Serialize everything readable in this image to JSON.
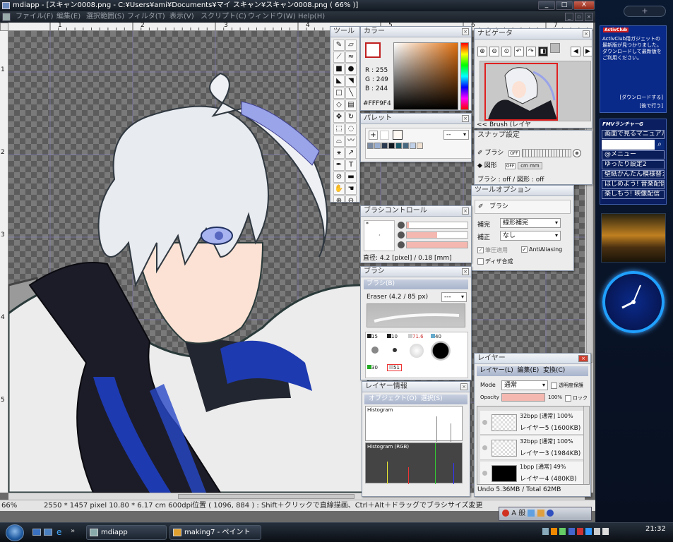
{
  "window": {
    "title": "mdiapp - [スキャン0008.png - C:¥Users¥ami¥Documents¥マイ スキャン¥スキャン0008.png ( 66% )]",
    "min": "_",
    "max": "□",
    "close": "X"
  },
  "menu": {
    "items": [
      "ファイル(F)",
      "編集(E)",
      "選択範囲(S)",
      "フィルタ(T)",
      "表示(V)",
      "スクリプト(C)",
      "ウィンドウ(W)",
      "Help(H)"
    ],
    "mdi_min": "_",
    "mdi_restore": "▫",
    "mdi_close": "×"
  },
  "ruler": {
    "top": [
      "1",
      "2",
      "3",
      "4",
      "5",
      "6",
      "7"
    ],
    "left": [
      "1",
      "2",
      "3",
      "4",
      "5"
    ]
  },
  "tools_panel": {
    "title": "ツール"
  },
  "color_panel": {
    "title": "カラー",
    "r": "R : 255",
    "g": "G : 249",
    "b": "B : 244",
    "hex": "#FFF9F4"
  },
  "palette_panel": {
    "title": "パレット",
    "add": "+",
    "dropdown": "--",
    "swatches": [
      "#7a8aa0",
      "#9aaed0",
      "#2a3a50",
      "#101820",
      "#1a5a6a",
      "#486880",
      "#c0d0e8",
      "#f0e0d0"
    ]
  },
  "navigator_panel": {
    "title": "ナビゲータ",
    "footer": "<< Brush (レイヤ"
  },
  "snap_panel": {
    "title": "スナップ設定",
    "brush_label": "ブラシ",
    "shape_label": "図形",
    "off1": "OFF",
    "off2": "OFF",
    "grid_label": "cm mm",
    "status": "ブラシ : off / 図形 : off"
  },
  "tool_option_panel": {
    "title": "ツールオプション",
    "tool": "ブラシ",
    "hokan_label": "補完",
    "hokan_value": "線形補完",
    "hosei_label": "補正",
    "hosei_value": "なし",
    "pressure": "筆圧適用",
    "antialiasing": "AntiAliasing",
    "dither": "ディザ合成"
  },
  "brush_control_panel": {
    "title": "ブラシコントロール",
    "star": "*",
    "dot": "·",
    "diameter": "直径: 4.2 [pixel] / 0.18 [mm]",
    "values": [
      0.04,
      0.5,
      1.0
    ]
  },
  "brush_panel": {
    "title": "ブラシ",
    "tab": "ブラシ(B)",
    "current": "Eraser (4.2 / 85 px)",
    "dropdown": "---",
    "sizes": [
      "15",
      "10",
      "71.6",
      "40",
      "30",
      "51"
    ]
  },
  "layer_info_panel": {
    "title": "レイヤー情報",
    "tab1": "オブジェクト(O)",
    "tab2": "選択(S)",
    "hist1": "Histogram",
    "hist2": "Histogram (RGB)"
  },
  "layer_panel": {
    "title": "レイヤー",
    "menu": [
      "レイヤー(L)",
      "編集(E)",
      "変換(C)"
    ],
    "mode_label": "Mode",
    "mode_value": "通常",
    "protect": "透明度保護",
    "opacity_label": "Opacity",
    "opacity_value": "100%",
    "lock": "ロック",
    "layers": [
      {
        "meta": "32bpp [通常] 100%",
        "name": "レイヤー5 (1600KB)"
      },
      {
        "meta": "32bpp [通常] 100%",
        "name": "レイヤー3 (1984KB)"
      },
      {
        "meta": "1bpp [通常] 49%",
        "name": "レイヤー4 (480KB)"
      }
    ],
    "undo": "Undo 5.36MB / Total 62MB"
  },
  "status": {
    "zoom": "66%",
    "size": "2550 * 1457 pixel  10.80 * 6.17 cm   600dpi",
    "hint": "位置 ( 1096, 884 ) : Shift＋クリックで直線描画、Ctrl＋Alt＋ドラッグでブラシサイズ変更"
  },
  "sidebar": {
    "top_plus": "+",
    "activeclub_logo": "ActivClub",
    "activeclub_text": "ActivClub用ガジェットの最新版が見つかりました。ダウンロードして最新版をご利用ください。",
    "download": "[ダウンロードする]",
    "later": "[後で行う]",
    "fmv_title": "FMVランチャーG",
    "fmv_items": [
      "画面で見るマニュアル",
      "@メニュー",
      "ゆったり設定2",
      "壁紙かんたん模様替え",
      "はじめよう! 音楽配信",
      "楽しもう! 映像配信"
    ]
  },
  "lang_bar": {
    "text": "A 般"
  },
  "taskbar": {
    "tasks": [
      "mdiapp",
      "making7 - ペイント"
    ],
    "clock": "21:32"
  }
}
